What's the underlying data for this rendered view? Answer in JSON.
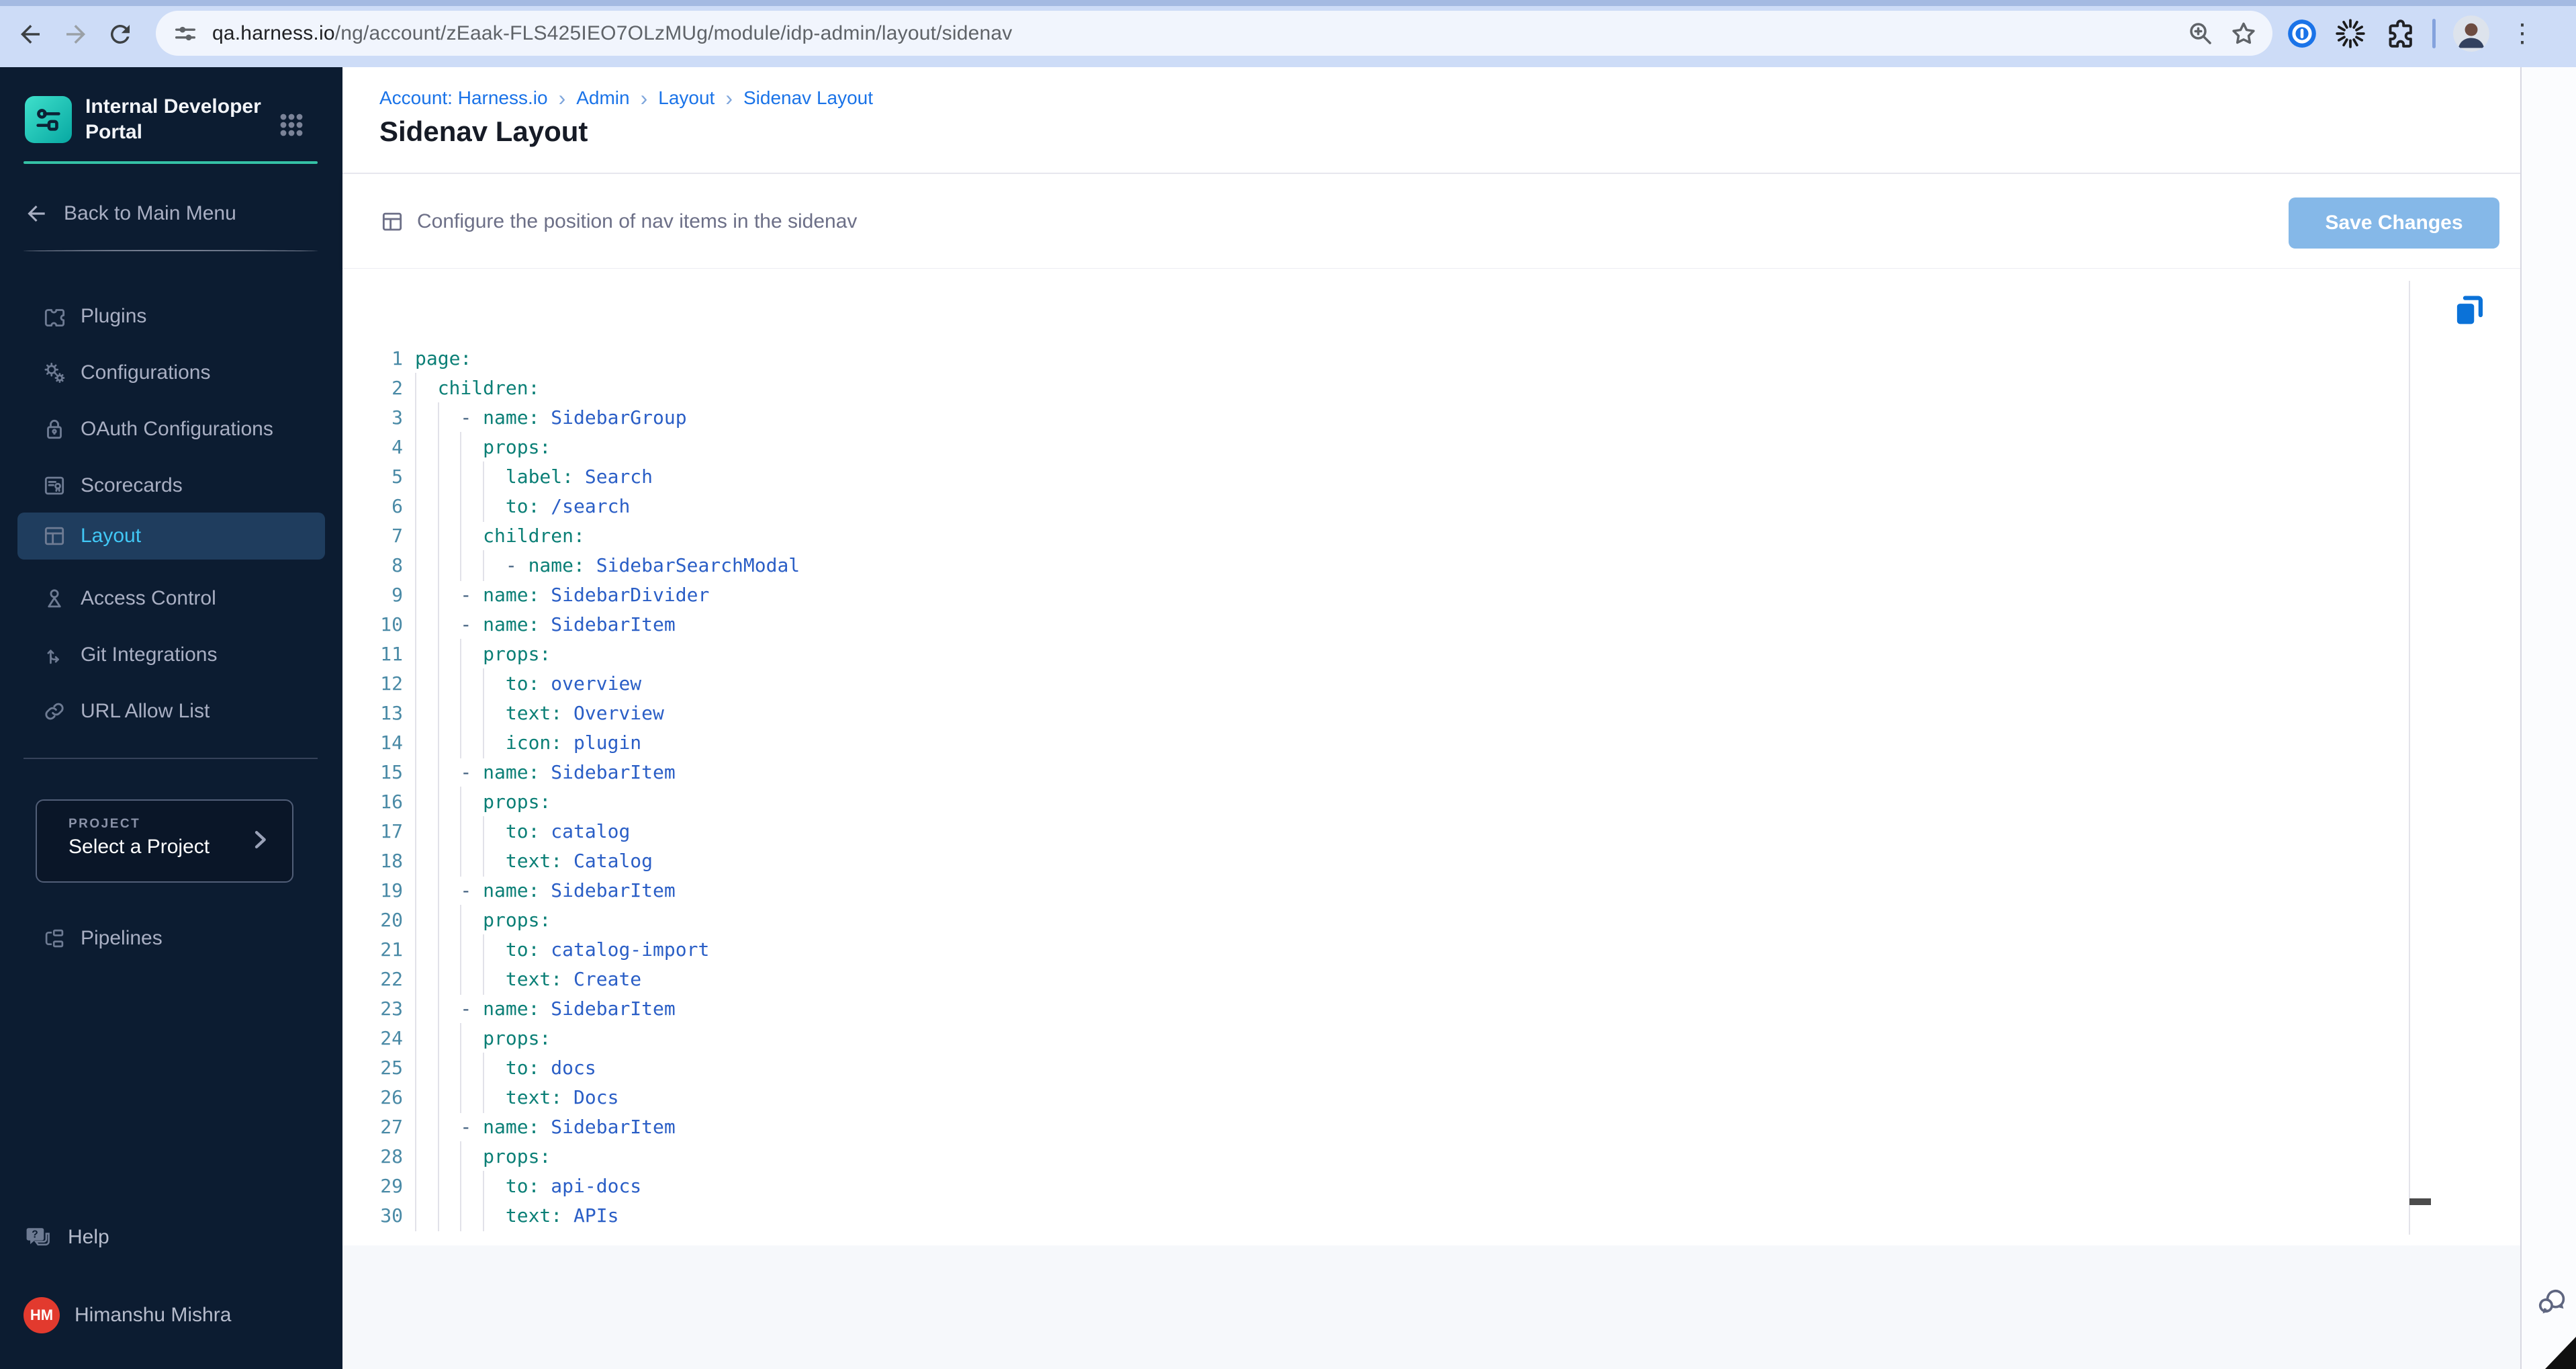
{
  "browser": {
    "url_host": "qa.harness.io",
    "url_path": "/ng/account/zEaak-FLS425IEO7OLzMUg/module/idp-admin/layout/sidenav",
    "icons": [
      "back-icon",
      "forward-icon",
      "reload-icon",
      "site-settings-icon",
      "zoom-icon",
      "bookmark-star-icon",
      "onepassword-icon",
      "spinner-extension-icon",
      "extensions-puzzle-icon",
      "profile-avatar",
      "menu-dots-icon"
    ],
    "menu_dots_glyph": "⋮"
  },
  "sidebar": {
    "logo_title": "Internal Developer Portal",
    "back_label": "Back to Main Menu",
    "items": [
      {
        "label": "Plugins",
        "icon": "puzzle-icon",
        "active": false
      },
      {
        "label": "Configurations",
        "icon": "gears-icon",
        "active": false
      },
      {
        "label": "OAuth Configurations",
        "icon": "lock-icon",
        "active": false
      },
      {
        "label": "Scorecards",
        "icon": "scorecard-icon",
        "active": false
      },
      {
        "label": "Layout",
        "icon": "layout-icon",
        "active": true
      },
      {
        "label": "Access Control",
        "icon": "person-icon",
        "active": false
      },
      {
        "label": "Git Integrations",
        "icon": "git-branch-icon",
        "active": false
      },
      {
        "label": "URL Allow List",
        "icon": "link-icon",
        "active": false
      }
    ],
    "project": {
      "eyebrow": "PROJECT",
      "label": "Select a Project"
    },
    "pipelines_label": "Pipelines",
    "help_label": "Help",
    "user": {
      "initials": "HM",
      "name": "Himanshu Mishra"
    }
  },
  "header": {
    "breadcrumb": [
      "Account: Harness.io",
      "Admin",
      "Layout",
      "Sidenav Layout"
    ],
    "separator": "›",
    "title": "Sidenav Layout"
  },
  "toolbar": {
    "description": "Configure the position of nav items in the sidenav",
    "save_label": "Save Changes"
  },
  "editor": {
    "language": "yaml",
    "lines": [
      {
        "n": 1,
        "indent": 0,
        "tokens": [
          [
            "k",
            "page:"
          ]
        ]
      },
      {
        "n": 2,
        "indent": 2,
        "tokens": [
          [
            "k",
            "children:"
          ]
        ]
      },
      {
        "n": 3,
        "indent": 4,
        "tokens": [
          [
            "d",
            "- "
          ],
          [
            "k",
            "name: "
          ],
          [
            "v",
            "SidebarGroup"
          ]
        ]
      },
      {
        "n": 4,
        "indent": 6,
        "tokens": [
          [
            "k",
            "props:"
          ]
        ]
      },
      {
        "n": 5,
        "indent": 8,
        "tokens": [
          [
            "k",
            "label: "
          ],
          [
            "v",
            "Search"
          ]
        ]
      },
      {
        "n": 6,
        "indent": 8,
        "tokens": [
          [
            "k",
            "to: "
          ],
          [
            "v",
            "/search"
          ]
        ]
      },
      {
        "n": 7,
        "indent": 6,
        "tokens": [
          [
            "k",
            "children:"
          ]
        ]
      },
      {
        "n": 8,
        "indent": 8,
        "tokens": [
          [
            "d",
            "- "
          ],
          [
            "k",
            "name: "
          ],
          [
            "v",
            "SidebarSearchModal"
          ]
        ]
      },
      {
        "n": 9,
        "indent": 4,
        "tokens": [
          [
            "d",
            "- "
          ],
          [
            "k",
            "name: "
          ],
          [
            "v",
            "SidebarDivider"
          ]
        ]
      },
      {
        "n": 10,
        "indent": 4,
        "tokens": [
          [
            "d",
            "- "
          ],
          [
            "k",
            "name: "
          ],
          [
            "v",
            "SidebarItem"
          ]
        ]
      },
      {
        "n": 11,
        "indent": 6,
        "tokens": [
          [
            "k",
            "props:"
          ]
        ]
      },
      {
        "n": 12,
        "indent": 8,
        "tokens": [
          [
            "k",
            "to: "
          ],
          [
            "v",
            "overview"
          ]
        ]
      },
      {
        "n": 13,
        "indent": 8,
        "tokens": [
          [
            "k",
            "text: "
          ],
          [
            "v",
            "Overview"
          ]
        ]
      },
      {
        "n": 14,
        "indent": 8,
        "tokens": [
          [
            "k",
            "icon: "
          ],
          [
            "v",
            "plugin"
          ]
        ]
      },
      {
        "n": 15,
        "indent": 4,
        "tokens": [
          [
            "d",
            "- "
          ],
          [
            "k",
            "name: "
          ],
          [
            "v",
            "SidebarItem"
          ]
        ]
      },
      {
        "n": 16,
        "indent": 6,
        "tokens": [
          [
            "k",
            "props:"
          ]
        ]
      },
      {
        "n": 17,
        "indent": 8,
        "tokens": [
          [
            "k",
            "to: "
          ],
          [
            "v",
            "catalog"
          ]
        ]
      },
      {
        "n": 18,
        "indent": 8,
        "tokens": [
          [
            "k",
            "text: "
          ],
          [
            "v",
            "Catalog"
          ]
        ]
      },
      {
        "n": 19,
        "indent": 4,
        "tokens": [
          [
            "d",
            "- "
          ],
          [
            "k",
            "name: "
          ],
          [
            "v",
            "SidebarItem"
          ]
        ]
      },
      {
        "n": 20,
        "indent": 6,
        "tokens": [
          [
            "k",
            "props:"
          ]
        ]
      },
      {
        "n": 21,
        "indent": 8,
        "tokens": [
          [
            "k",
            "to: "
          ],
          [
            "v",
            "catalog-import"
          ]
        ]
      },
      {
        "n": 22,
        "indent": 8,
        "tokens": [
          [
            "k",
            "text: "
          ],
          [
            "v",
            "Create"
          ]
        ]
      },
      {
        "n": 23,
        "indent": 4,
        "tokens": [
          [
            "d",
            "- "
          ],
          [
            "k",
            "name: "
          ],
          [
            "v",
            "SidebarItem"
          ]
        ]
      },
      {
        "n": 24,
        "indent": 6,
        "tokens": [
          [
            "k",
            "props:"
          ]
        ]
      },
      {
        "n": 25,
        "indent": 8,
        "tokens": [
          [
            "k",
            "to: "
          ],
          [
            "v",
            "docs"
          ]
        ]
      },
      {
        "n": 26,
        "indent": 8,
        "tokens": [
          [
            "k",
            "text: "
          ],
          [
            "v",
            "Docs"
          ]
        ]
      },
      {
        "n": 27,
        "indent": 4,
        "tokens": [
          [
            "d",
            "- "
          ],
          [
            "k",
            "name: "
          ],
          [
            "v",
            "SidebarItem"
          ]
        ]
      },
      {
        "n": 28,
        "indent": 6,
        "tokens": [
          [
            "k",
            "props:"
          ]
        ]
      },
      {
        "n": 29,
        "indent": 8,
        "tokens": [
          [
            "k",
            "to: "
          ],
          [
            "v",
            "api-docs"
          ]
        ]
      },
      {
        "n": 30,
        "indent": 8,
        "tokens": [
          [
            "k",
            "text: "
          ],
          [
            "v",
            "APIs"
          ]
        ]
      }
    ]
  },
  "colors": {
    "sidebar_bg": "#0c1c31",
    "sidebar_active_bg": "#1f3d5e",
    "sidebar_active_text": "#41c7f5",
    "accent_teal": "#35c1a5",
    "breadcrumb_blue": "#1a73e8",
    "save_button_bg": "#85b8e8",
    "code_key": "#0b7f76",
    "code_value": "#2a5ec6",
    "code_dash": "#41607f",
    "code_line_number": "#4a8aa6",
    "avatar_red": "#e23a2e",
    "copy_icon_blue": "#0b72d8"
  }
}
